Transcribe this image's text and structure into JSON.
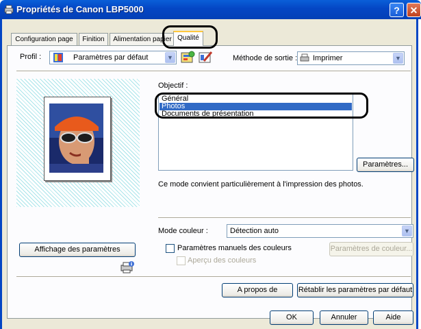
{
  "window": {
    "title": "Propriétés de Canon LBP5000",
    "help_label": "?",
    "close_label": "✕"
  },
  "tabs": [
    {
      "label": "Configuration page"
    },
    {
      "label": "Finition"
    },
    {
      "label": "Alimentation papier"
    },
    {
      "label": "Qualité"
    }
  ],
  "profile": {
    "label": "Profil :",
    "value": "Paramètres par défaut"
  },
  "output": {
    "label": "Méthode de sortie :",
    "value": "Imprimer"
  },
  "objective": {
    "label": "Objectif :",
    "items": [
      "Général",
      "Photos",
      "Documents de présentation"
    ],
    "selected_index": 1
  },
  "params_button": "Paramètres...",
  "description": "Ce mode convient particulièrement à l'impression des photos.",
  "color_mode": {
    "label": "Mode couleur :",
    "value": "Détection auto"
  },
  "manual_colors": {
    "label": "Paramètres manuels des couleurs",
    "checked": false
  },
  "color_params_button": "Paramètres de couleur...",
  "color_preview": {
    "label": "Aperçu des couleurs",
    "checked": false
  },
  "view_settings_button": "Affichage des paramètres",
  "about_button": "A propos de",
  "restore_button": "Rétablir les paramètres par défaut",
  "footer": {
    "ok": "OK",
    "cancel": "Annuler",
    "help": "Aide"
  },
  "colors": {
    "title_bar": "#0446c4",
    "selection": "#316ac5",
    "dialog_bg": "#ece9d8"
  },
  "icons": [
    "printer-icon",
    "profile-icon",
    "add-profile-icon",
    "edit-profile-icon",
    "output-printer-icon",
    "printer-info-icon",
    "photo-preview"
  ]
}
